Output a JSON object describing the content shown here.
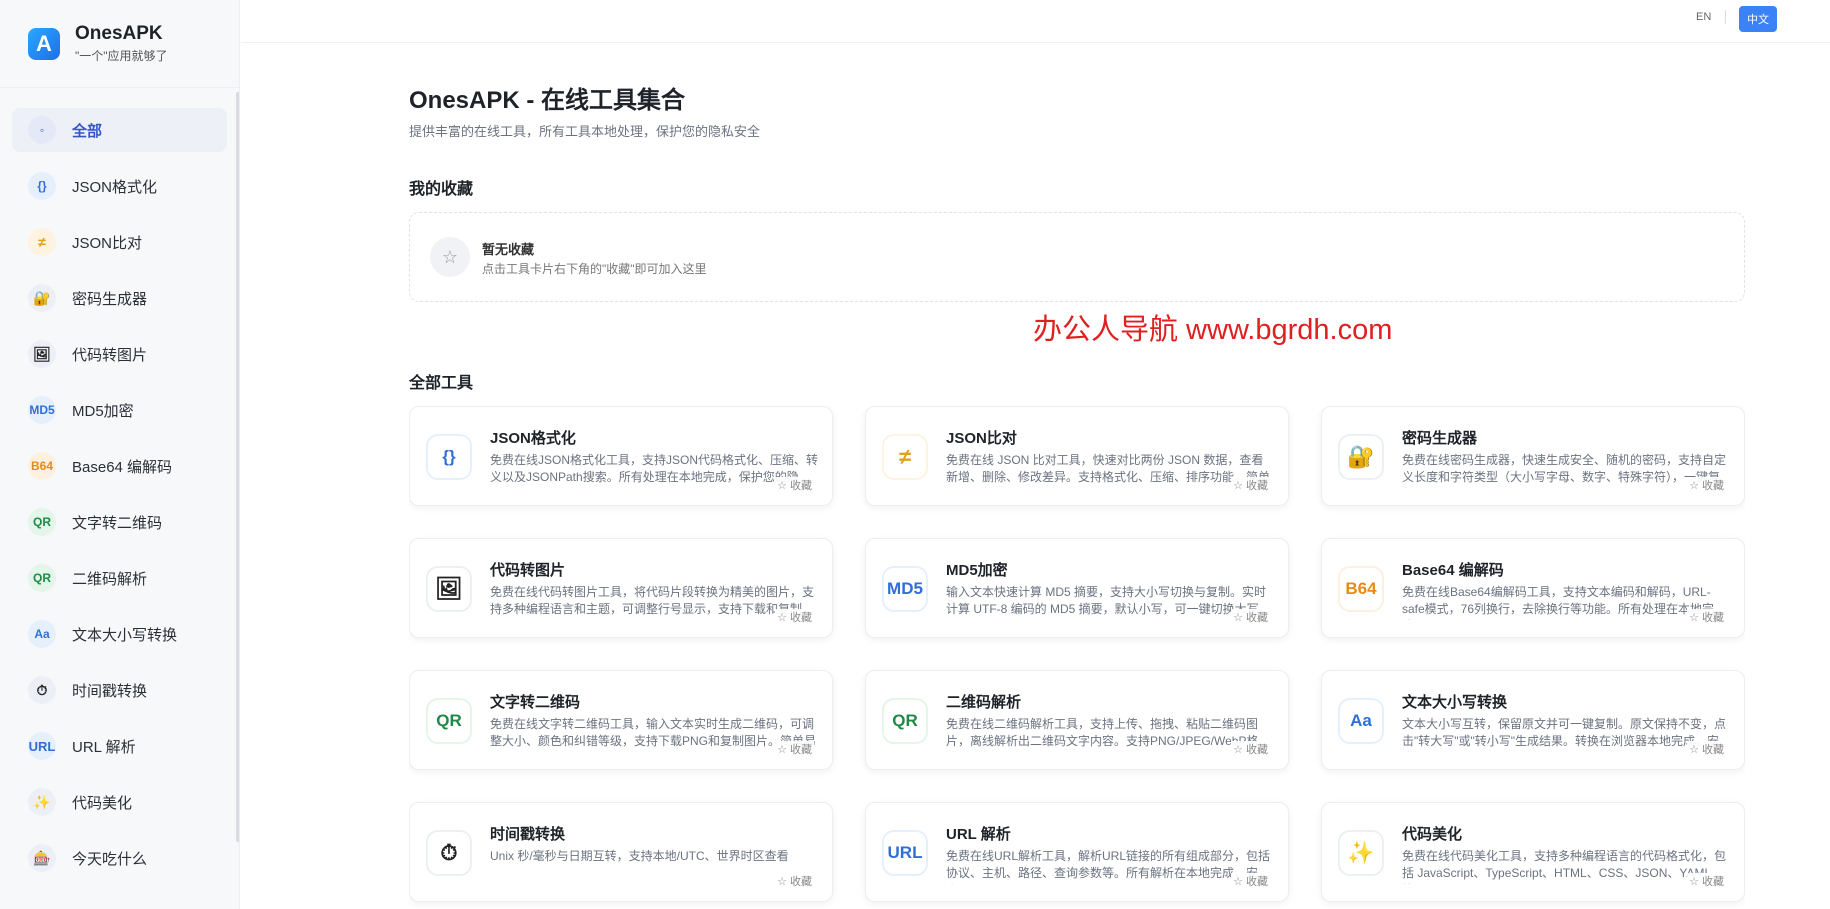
{
  "brand": {
    "name": "OnesAPK",
    "subtitle": "\"一个\"应用就够了",
    "logo_letter": "A"
  },
  "lang": {
    "en": "EN",
    "zh": "中文"
  },
  "sidebar": {
    "items": [
      {
        "label": "全部",
        "icon": "◦",
        "icon_name": "all-icon"
      },
      {
        "label": "JSON格式化",
        "icon": "{}",
        "icon_name": "json-braces-icon"
      },
      {
        "label": "JSON比对",
        "icon": "≠",
        "icon_name": "not-equal-icon"
      },
      {
        "label": "密码生成器",
        "icon": "🔐",
        "icon_name": "lock-icon"
      },
      {
        "label": "代码转图片",
        "icon": "🖼",
        "icon_name": "picture-icon"
      },
      {
        "label": "MD5加密",
        "icon": "MD5",
        "icon_name": "md5-icon"
      },
      {
        "label": "Base64 编解码",
        "icon": "B64",
        "icon_name": "b64-icon"
      },
      {
        "label": "文字转二维码",
        "icon": "QR",
        "icon_name": "qr-icon"
      },
      {
        "label": "二维码解析",
        "icon": "QR",
        "icon_name": "qr-scan-icon"
      },
      {
        "label": "文本大小写转换",
        "icon": "Aa",
        "icon_name": "case-icon"
      },
      {
        "label": "时间戳转换",
        "icon": "⏱",
        "icon_name": "stopwatch-icon"
      },
      {
        "label": "URL 解析",
        "icon": "URL",
        "icon_name": "url-icon"
      },
      {
        "label": "代码美化",
        "icon": "✨",
        "icon_name": "sparkles-icon"
      },
      {
        "label": "今天吃什么",
        "icon": "🎰",
        "icon_name": "dice-icon"
      }
    ]
  },
  "main": {
    "title": "OnesAPK - 在线工具集合",
    "subtitle": "提供丰富的在线工具，所有工具本地处理，保护您的隐私安全",
    "favorites_heading": "我的收藏",
    "favorites_empty_title": "暂无收藏",
    "favorites_empty_desc": "点击工具卡片右下角的\"收藏\"即可加入这里",
    "all_tools_heading": "全部工具",
    "fav_label": "☆ 收藏"
  },
  "watermark": "办公人导航 www.bgrdh.com",
  "tools": [
    {
      "title": "JSON格式化",
      "icon": "{}",
      "icon_name": "json-braces-icon",
      "desc": "免费在线JSON格式化工具，支持JSON代码格式化、压缩、转义以及JSONPath搜索。所有处理在本地完成，保护您的隐私。"
    },
    {
      "title": "JSON比对",
      "icon": "≠",
      "icon_name": "not-equal-icon",
      "desc": "免费在线 JSON 比对工具，快速对比两份 JSON 数据，查看新增、删除、修改差异。支持格式化、压缩、排序功能，简单易用。"
    },
    {
      "title": "密码生成器",
      "icon": "🔐",
      "icon_name": "lock-icon",
      "desc": "免费在线密码生成器，快速生成安全、随机的密码，支持自定义长度和字符类型（大小写字母、数字、特殊字符），一键复制。"
    },
    {
      "title": "代码转图片",
      "icon": "🖼",
      "icon_name": "picture-icon",
      "desc": "免费在线代码转图片工具，将代码片段转换为精美的图片，支持多种编程语言和主题，可调整行号显示，支持下载和复制。"
    },
    {
      "title": "MD5加密",
      "icon": "MD5",
      "icon_name": "md5-icon",
      "desc": "输入文本快速计算 MD5 摘要，支持大小写切换与复制。实时计算 UTF-8 编码的 MD5 摘要，默认小写，可一键切换大写。"
    },
    {
      "title": "Base64 编解码",
      "icon": "B64",
      "icon_name": "b64-icon",
      "desc": "免费在线Base64编解码工具，支持文本编码和解码，URL-safe模式，76列换行，去除换行等功能。所有处理在本地完成。"
    },
    {
      "title": "文字转二维码",
      "icon": "QR",
      "icon_name": "qr-icon",
      "desc": "免费在线文字转二维码工具，输入文本实时生成二维码，可调整大小、颜色和纠错等级，支持下载PNG和复制图片。简单易用。"
    },
    {
      "title": "二维码解析",
      "icon": "QR",
      "icon_name": "qr-scan-icon",
      "desc": "免费在线二维码解析工具，支持上传、拖拽、粘贴二维码图片，离线解析出二维码文字内容。支持PNG/JPEG/WebP格式。"
    },
    {
      "title": "文本大小写转换",
      "icon": "Aa",
      "icon_name": "case-icon",
      "desc": "文本大小写互转，保留原文并可一键复制。原文保持不变，点击\"转大写\"或\"转小写\"生成结果。转换在浏览器本地完成，安全。"
    },
    {
      "title": "时间戳转换",
      "icon": "⏱",
      "icon_name": "stopwatch-icon",
      "desc": "Unix 秒/毫秒与日期互转，支持本地/UTC、世界时区查看"
    },
    {
      "title": "URL 解析",
      "icon": "URL",
      "icon_name": "url-icon",
      "desc": "免费在线URL解析工具，解析URL链接的所有组成部分，包括协议、主机、路径、查询参数等。所有解析在本地完成，安全。"
    },
    {
      "title": "代码美化",
      "icon": "✨",
      "icon_name": "sparkles-icon",
      "desc": "免费在线代码美化工具，支持多种编程语言的代码格式化，包括 JavaScript、TypeScript、HTML、CSS、JSON、YAML等。"
    }
  ],
  "colors": {
    "accent": "#3b82f6",
    "active_nav_bg": "#eef0f7",
    "active_nav_text": "#3556c9",
    "watermark": "#e02020"
  }
}
